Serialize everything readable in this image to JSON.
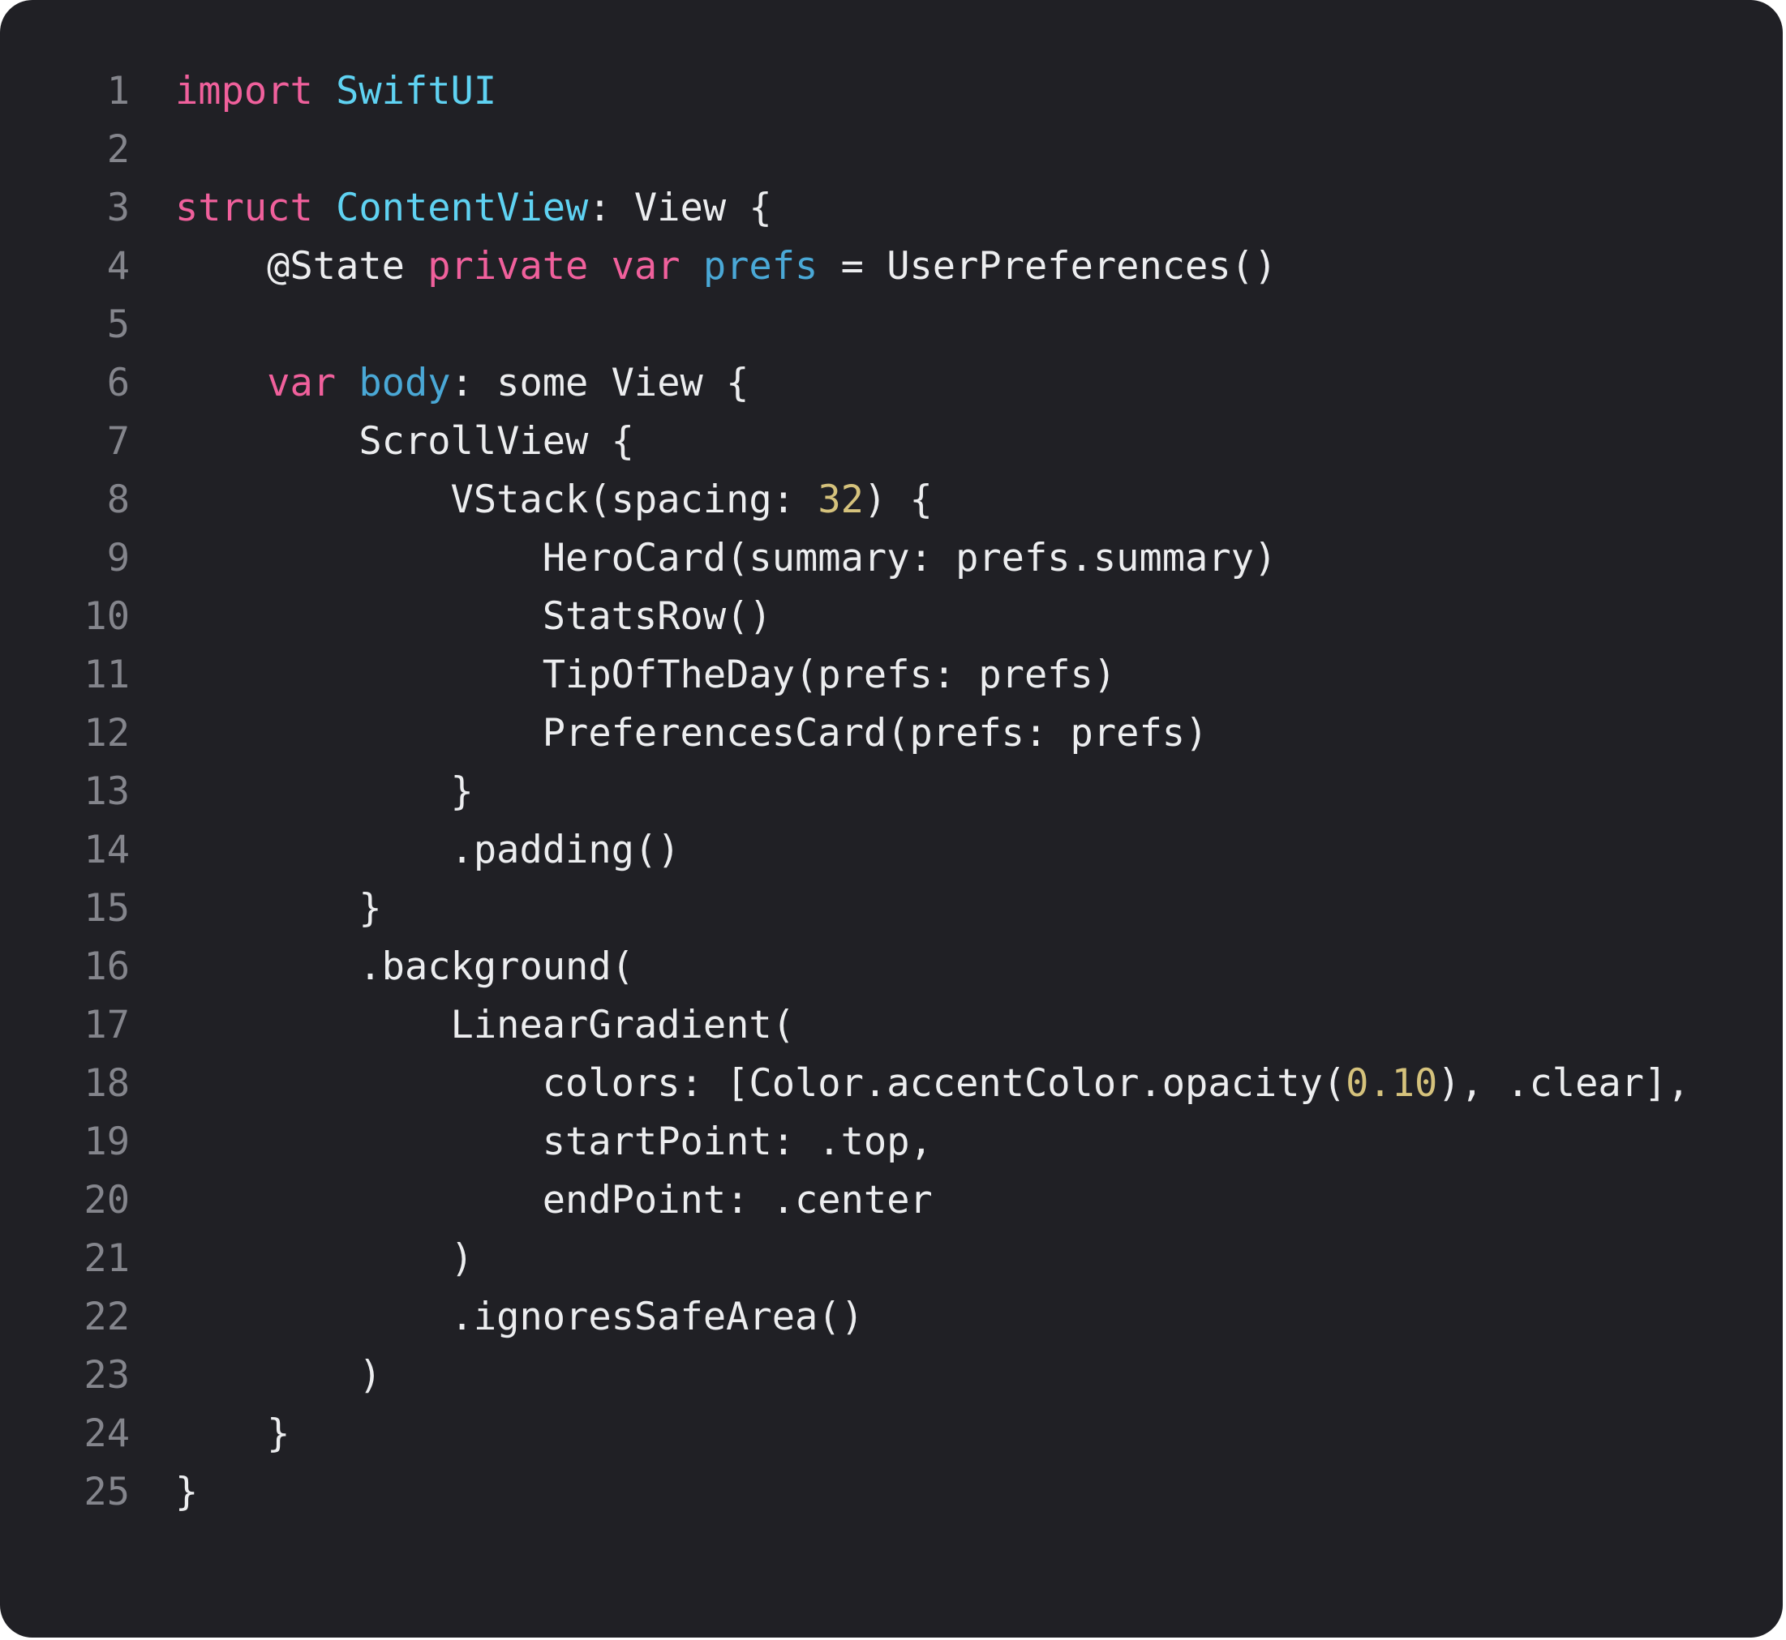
{
  "editor": {
    "lines": [
      {
        "number": "1",
        "tokens": [
          {
            "t": "import",
            "k": "kw"
          },
          {
            "t": " ",
            "k": "pl"
          },
          {
            "t": "SwiftUI",
            "k": "ty"
          }
        ]
      },
      {
        "number": "2",
        "tokens": []
      },
      {
        "number": "3",
        "tokens": [
          {
            "t": "struct",
            "k": "kw"
          },
          {
            "t": " ",
            "k": "pl"
          },
          {
            "t": "ContentView",
            "k": "ty"
          },
          {
            "t": ": View {",
            "k": "pl"
          }
        ]
      },
      {
        "number": "4",
        "tokens": [
          {
            "t": "    @State ",
            "k": "pl"
          },
          {
            "t": "private",
            "k": "kw"
          },
          {
            "t": " ",
            "k": "pl"
          },
          {
            "t": "var",
            "k": "kw"
          },
          {
            "t": " ",
            "k": "pl"
          },
          {
            "t": "prefs",
            "k": "id"
          },
          {
            "t": " = UserPreferences()",
            "k": "pl"
          }
        ]
      },
      {
        "number": "5",
        "tokens": []
      },
      {
        "number": "6",
        "tokens": [
          {
            "t": "    ",
            "k": "pl"
          },
          {
            "t": "var",
            "k": "kw"
          },
          {
            "t": " ",
            "k": "pl"
          },
          {
            "t": "body",
            "k": "id"
          },
          {
            "t": ": some View {",
            "k": "pl"
          }
        ]
      },
      {
        "number": "7",
        "tokens": [
          {
            "t": "        ScrollView {",
            "k": "pl"
          }
        ]
      },
      {
        "number": "8",
        "tokens": [
          {
            "t": "            VStack(spacing: ",
            "k": "pl"
          },
          {
            "t": "32",
            "k": "num"
          },
          {
            "t": ") {",
            "k": "pl"
          }
        ]
      },
      {
        "number": "9",
        "tokens": [
          {
            "t": "                HeroCard(summary: prefs.summary)",
            "k": "pl"
          }
        ]
      },
      {
        "number": "10",
        "tokens": [
          {
            "t": "                StatsRow()",
            "k": "pl"
          }
        ]
      },
      {
        "number": "11",
        "tokens": [
          {
            "t": "                TipOfTheDay(prefs: prefs)",
            "k": "pl"
          }
        ]
      },
      {
        "number": "12",
        "tokens": [
          {
            "t": "                PreferencesCard(prefs: prefs)",
            "k": "pl"
          }
        ]
      },
      {
        "number": "13",
        "tokens": [
          {
            "t": "            }",
            "k": "pl"
          }
        ]
      },
      {
        "number": "14",
        "tokens": [
          {
            "t": "            .padding()",
            "k": "pl"
          }
        ]
      },
      {
        "number": "15",
        "tokens": [
          {
            "t": "        }",
            "k": "pl"
          }
        ]
      },
      {
        "number": "16",
        "tokens": [
          {
            "t": "        .background(",
            "k": "pl"
          }
        ]
      },
      {
        "number": "17",
        "tokens": [
          {
            "t": "            LinearGradient(",
            "k": "pl"
          }
        ]
      },
      {
        "number": "18",
        "tokens": [
          {
            "t": "                colors: [Color.accentColor.opacity(",
            "k": "pl"
          },
          {
            "t": "0.10",
            "k": "num"
          },
          {
            "t": "), .clear],",
            "k": "pl"
          }
        ]
      },
      {
        "number": "19",
        "tokens": [
          {
            "t": "                startPoint: .top,",
            "k": "pl"
          }
        ]
      },
      {
        "number": "20",
        "tokens": [
          {
            "t": "                endPoint: .center",
            "k": "pl"
          }
        ]
      },
      {
        "number": "21",
        "tokens": [
          {
            "t": "            )",
            "k": "pl"
          }
        ]
      },
      {
        "number": "22",
        "tokens": [
          {
            "t": "            .ignoresSafeArea()",
            "k": "pl"
          }
        ]
      },
      {
        "number": "23",
        "tokens": [
          {
            "t": "        )",
            "k": "pl"
          }
        ]
      },
      {
        "number": "24",
        "tokens": [
          {
            "t": "    }",
            "k": "pl"
          }
        ]
      },
      {
        "number": "25",
        "tokens": [
          {
            "t": "}",
            "k": "pl"
          }
        ]
      }
    ]
  },
  "colors": {
    "background": "#202025",
    "keyword": "#f0609c",
    "type": "#5fd2f2",
    "identifier": "#4aa8d6",
    "number": "#d5c27c",
    "plain": "#ecedef",
    "line_number": "#84858c"
  }
}
